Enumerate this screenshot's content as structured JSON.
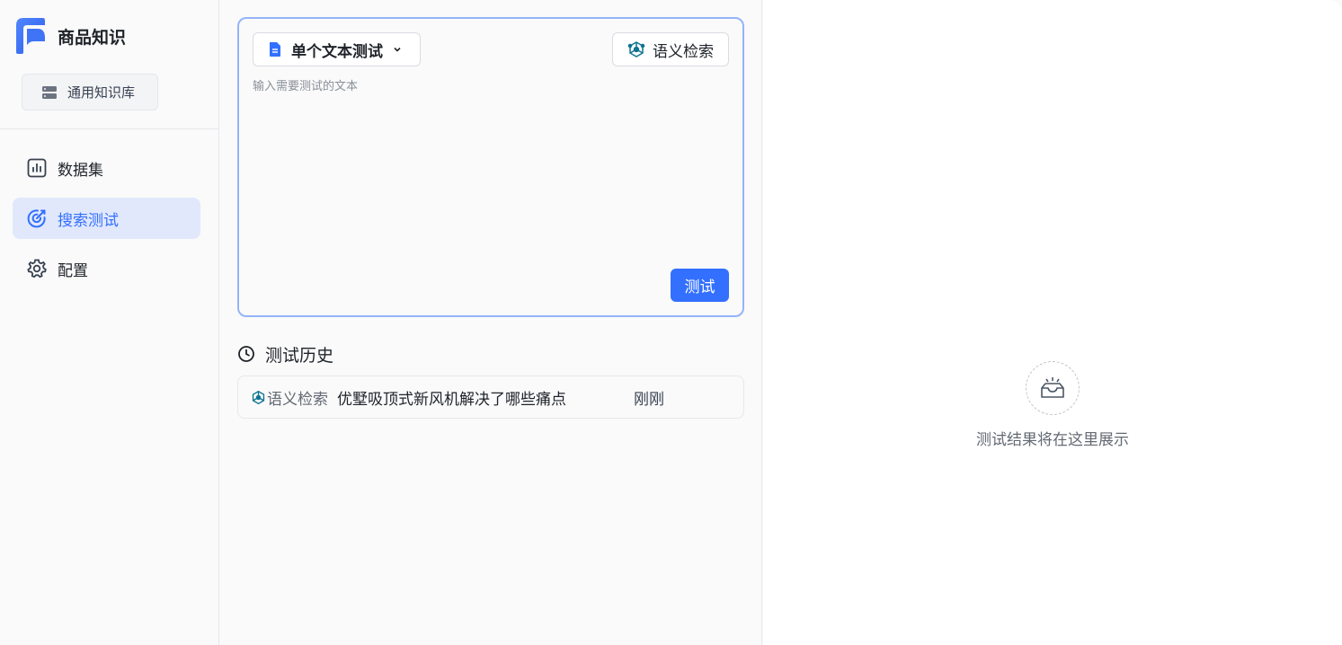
{
  "app": {
    "title": "商品知识"
  },
  "sidebar": {
    "kb_button_label": "通用知识库",
    "items": [
      {
        "label": "数据集",
        "icon": "bar-chart-icon",
        "active": false
      },
      {
        "label": "搜索测试",
        "icon": "target-icon",
        "active": true
      },
      {
        "label": "配置",
        "icon": "gear-icon",
        "active": false
      }
    ]
  },
  "test_panel": {
    "mode_label": "单个文本测试",
    "method_label": "语义检索",
    "input_value": "",
    "input_placeholder": "输入需要测试的文本",
    "submit_label": "测试"
  },
  "history": {
    "title": "测试历史",
    "rows": [
      {
        "method": "语义检索",
        "query": "优墅吸顶式新风机解决了哪些痛点",
        "time": "刚刚"
      }
    ]
  },
  "results": {
    "empty_text": "测试结果将在这里展示"
  },
  "colors": {
    "accent": "#3370ff",
    "active_bg": "#e1e8fc",
    "card_border": "#94b4fb"
  }
}
